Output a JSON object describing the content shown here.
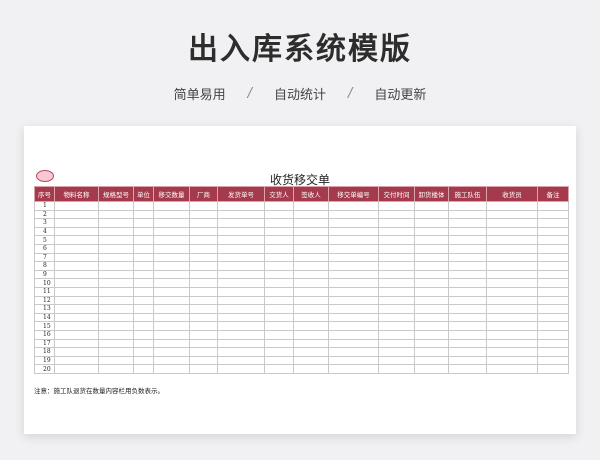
{
  "hero": {
    "title": "出入库系统模版",
    "features": [
      "简单易用",
      "自动统计",
      "自动更新"
    ],
    "separator": "/"
  },
  "sheet": {
    "title": "收货移交单",
    "columns": [
      "序号",
      "物料名称",
      "规格型号",
      "单位",
      "移交数量",
      "厂商",
      "发货单号",
      "交货人",
      "签收人",
      "移交单编号",
      "交付时间",
      "卸货楼体",
      "施工队伍",
      "收货员",
      "备注"
    ],
    "rows": [
      "1",
      "2",
      "3",
      "4",
      "5",
      "6",
      "7",
      "8",
      "9",
      "10",
      "11",
      "12",
      "13",
      "14",
      "15",
      "16",
      "17",
      "18",
      "19",
      "20"
    ],
    "note": "注意：施工队退货在数量内容栏用负数表示。"
  },
  "colors": {
    "header_bg": "#a53a4c",
    "header_text": "#ffffff",
    "bubble": "#f7c8cf"
  }
}
